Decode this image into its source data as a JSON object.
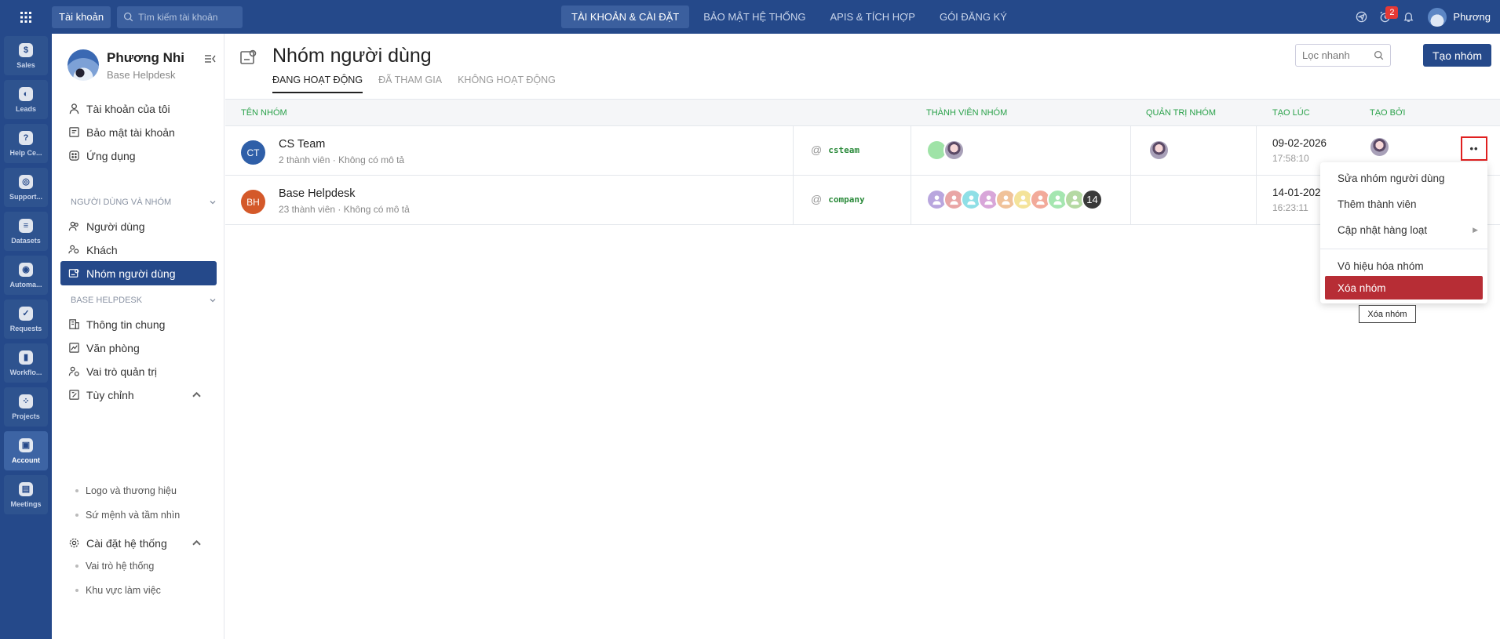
{
  "topbar": {
    "account_chip": "Tài khoản",
    "search_placeholder": "Tìm kiếm tài khoản",
    "nav": [
      "TÀI KHOẢN & CÀI ĐẶT",
      "BẢO MẬT HỆ THỐNG",
      "APIS & TÍCH HỢP",
      "GÓI ĐĂNG KÝ"
    ],
    "notification_count": "2",
    "user_name": "Phương"
  },
  "rail": [
    "Sales",
    "Leads",
    "Help Ce...",
    "Support...",
    "Datasets",
    "Automa...",
    "Requests",
    "Workflo...",
    "Projects",
    "Account",
    "Meetings"
  ],
  "sidebar": {
    "profile_name": "Phương Nhi",
    "profile_sub": "Base Helpdesk",
    "top_items": [
      "Tài khoản của tôi",
      "Bảo mật tài khoản",
      "Ứng dụng"
    ],
    "section1": "NGƯỜI DÙNG VÀ NHÓM",
    "section1_items": [
      "Người dùng",
      "Khách",
      "Nhóm người dùng"
    ],
    "section2": "BASE HELPDESK",
    "section2_items": [
      "Thông tin chung",
      "Văn phòng",
      "Vai trò quản trị"
    ],
    "customize": "Tùy chỉnh",
    "customize_subs": [
      "Logo và thương hiệu",
      "Sứ mệnh và tầm nhìn"
    ],
    "system": "Cài đặt hệ thống",
    "system_subs": [
      "Vai trò hệ thống",
      "Khu vực làm việc"
    ]
  },
  "main": {
    "title": "Nhóm người dùng",
    "tabs": [
      "ĐANG HOẠT ĐỘNG",
      "ĐÃ THAM GIA",
      "KHÔNG HOẠT ĐỘNG"
    ],
    "quick_search": "Lọc nhanh",
    "create_button": "Tạo nhóm",
    "columns": [
      "TÊN NHÓM",
      "THÀNH VIÊN NHÓM",
      "QUẢN TRỊ NHÓM",
      "TẠO LÚC",
      "TẠO BỞI"
    ],
    "rows": [
      {
        "initials": "CT",
        "name": "CS Team",
        "desc": "2 thành viên · Không có mô tả",
        "alias": "csteam",
        "date": "09-02-2026",
        "time": "17:58:10",
        "color": "#2f5fa8"
      },
      {
        "initials": "BH",
        "name": "Base Helpdesk",
        "desc": "23 thành viên · Không có mô tả",
        "alias": "company",
        "date": "14-01-2026",
        "time": "16:23:11",
        "color": "#d4592a",
        "more_members": "14"
      }
    ]
  },
  "menu": {
    "items": [
      "Sửa nhóm người dùng",
      "Thêm thành viên",
      "Cập nhật hàng loạt",
      "Vô hiệu hóa nhóm",
      "Xóa nhóm"
    ],
    "tooltip": "Xóa nhóm"
  }
}
